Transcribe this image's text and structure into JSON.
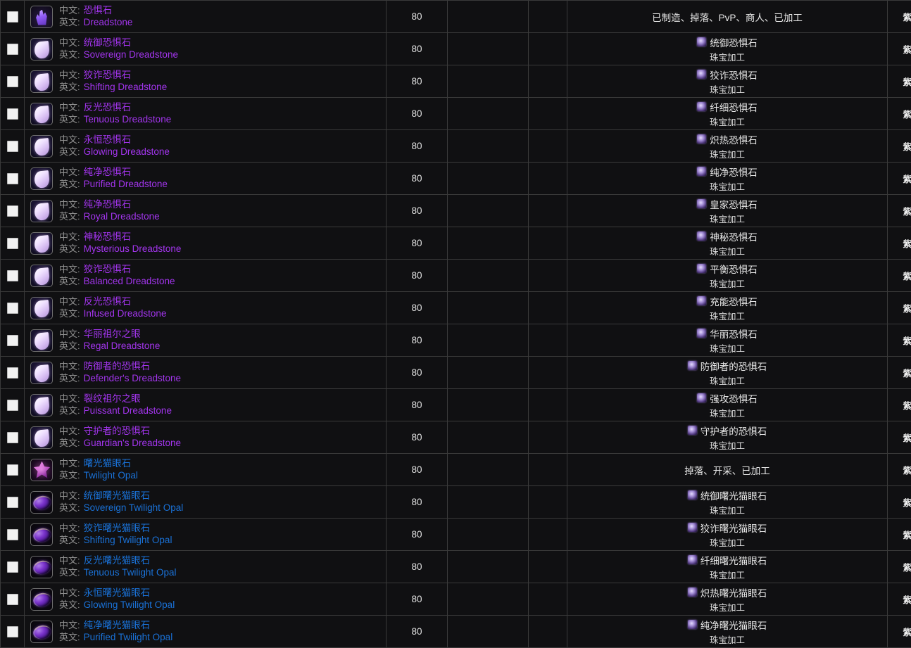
{
  "labels": {
    "chinese_prefix": "中文:",
    "english_prefix": "英文:",
    "profession": "珠宝加工",
    "category_purple_gem": "紫色宝石"
  },
  "colors": {
    "epic_purple": "#a335ee",
    "rare_blue": "#1a72d8",
    "row_background": "#101012",
    "grid_line": "#3a3a3a"
  },
  "rows": [
    {
      "icon": "crystal-cluster-icon",
      "quality": "epic",
      "cn": "恐惧石",
      "en": "Dreadstone",
      "level": "80",
      "source_text": "已制造、掉落、PvP、商人、已加工",
      "source_item": null,
      "source_prof": null,
      "category": "紫色宝石"
    },
    {
      "icon": "teardrop-gem-icon",
      "quality": "epic",
      "cn": "统御恐惧石",
      "en": "Sovereign Dreadstone",
      "level": "80",
      "source_text": null,
      "source_item": "统御恐惧石",
      "source_prof": "珠宝加工",
      "category": "紫色宝石"
    },
    {
      "icon": "teardrop-gem-icon",
      "quality": "epic",
      "cn": "狡诈恐惧石",
      "en": "Shifting Dreadstone",
      "level": "80",
      "source_text": null,
      "source_item": "狡诈恐惧石",
      "source_prof": "珠宝加工",
      "category": "紫色宝石"
    },
    {
      "icon": "teardrop-gem-icon",
      "quality": "epic",
      "cn": "反光恐惧石",
      "en": "Tenuous Dreadstone",
      "level": "80",
      "source_text": null,
      "source_item": "纤细恐惧石",
      "source_prof": "珠宝加工",
      "category": "紫色宝石"
    },
    {
      "icon": "teardrop-gem-icon",
      "quality": "epic",
      "cn": "永恒恐惧石",
      "en": "Glowing Dreadstone",
      "level": "80",
      "source_text": null,
      "source_item": "炽热恐惧石",
      "source_prof": "珠宝加工",
      "category": "紫色宝石"
    },
    {
      "icon": "teardrop-gem-icon",
      "quality": "epic",
      "cn": "纯净恐惧石",
      "en": "Purified Dreadstone",
      "level": "80",
      "source_text": null,
      "source_item": "纯净恐惧石",
      "source_prof": "珠宝加工",
      "category": "紫色宝石"
    },
    {
      "icon": "teardrop-gem-icon",
      "quality": "epic",
      "cn": "纯净恐惧石",
      "en": "Royal Dreadstone",
      "level": "80",
      "source_text": null,
      "source_item": "皇家恐惧石",
      "source_prof": "珠宝加工",
      "category": "紫色宝石"
    },
    {
      "icon": "teardrop-gem-icon",
      "quality": "epic",
      "cn": "神秘恐惧石",
      "en": "Mysterious Dreadstone",
      "level": "80",
      "source_text": null,
      "source_item": "神秘恐惧石",
      "source_prof": "珠宝加工",
      "category": "紫色宝石"
    },
    {
      "icon": "teardrop-gem-icon",
      "quality": "epic",
      "cn": "狡诈恐惧石",
      "en": "Balanced Dreadstone",
      "level": "80",
      "source_text": null,
      "source_item": "平衡恐惧石",
      "source_prof": "珠宝加工",
      "category": "紫色宝石"
    },
    {
      "icon": "teardrop-gem-icon",
      "quality": "epic",
      "cn": "反光恐惧石",
      "en": "Infused Dreadstone",
      "level": "80",
      "source_text": null,
      "source_item": "充能恐惧石",
      "source_prof": "珠宝加工",
      "category": "紫色宝石"
    },
    {
      "icon": "teardrop-gem-icon",
      "quality": "epic",
      "cn": "华丽祖尔之眼",
      "en": "Regal Dreadstone",
      "level": "80",
      "source_text": null,
      "source_item": "华丽恐惧石",
      "source_prof": "珠宝加工",
      "category": "紫色宝石"
    },
    {
      "icon": "teardrop-gem-icon",
      "quality": "epic",
      "cn": "防御者的恐惧石",
      "en": "Defender's Dreadstone",
      "level": "80",
      "source_text": null,
      "source_item": "防御者的恐惧石",
      "source_prof": "珠宝加工",
      "category": "紫色宝石"
    },
    {
      "icon": "teardrop-gem-icon",
      "quality": "epic",
      "cn": "裂纹祖尔之眼",
      "en": "Puissant Dreadstone",
      "level": "80",
      "source_text": null,
      "source_item": "强攻恐惧石",
      "source_prof": "珠宝加工",
      "category": "紫色宝石"
    },
    {
      "icon": "teardrop-gem-icon",
      "quality": "epic",
      "cn": "守护者的恐惧石",
      "en": "Guardian's Dreadstone",
      "level": "80",
      "source_text": null,
      "source_item": "守护者的恐惧石",
      "source_prof": "珠宝加工",
      "category": "紫色宝石"
    },
    {
      "icon": "star-opal-icon",
      "quality": "rare",
      "cn": "曙光猫眼石",
      "en": "Twilight Opal",
      "level": "80",
      "source_text": "掉落、开采、已加工",
      "source_item": null,
      "source_prof": null,
      "category": "紫色宝石"
    },
    {
      "icon": "oval-opal-icon",
      "quality": "rare",
      "cn": "统御曙光猫眼石",
      "en": "Sovereign Twilight Opal",
      "level": "80",
      "source_text": null,
      "source_item": "统御曙光猫眼石",
      "source_prof": "珠宝加工",
      "category": "紫色宝石"
    },
    {
      "icon": "oval-opal-icon",
      "quality": "rare",
      "cn": "狡诈曙光猫眼石",
      "en": "Shifting Twilight Opal",
      "level": "80",
      "source_text": null,
      "source_item": "狡诈曙光猫眼石",
      "source_prof": "珠宝加工",
      "category": "紫色宝石"
    },
    {
      "icon": "oval-opal-icon",
      "quality": "rare",
      "cn": "反光曙光猫眼石",
      "en": "Tenuous Twilight Opal",
      "level": "80",
      "source_text": null,
      "source_item": "纤细曙光猫眼石",
      "source_prof": "珠宝加工",
      "category": "紫色宝石"
    },
    {
      "icon": "oval-opal-icon",
      "quality": "rare",
      "cn": "永恒曙光猫眼石",
      "en": "Glowing Twilight Opal",
      "level": "80",
      "source_text": null,
      "source_item": "炽热曙光猫眼石",
      "source_prof": "珠宝加工",
      "category": "紫色宝石"
    },
    {
      "icon": "oval-opal-icon",
      "quality": "rare",
      "cn": "纯净曙光猫眼石",
      "en": "Purified Twilight Opal",
      "level": "80",
      "source_text": null,
      "source_item": "纯净曙光猫眼石",
      "source_prof": "珠宝加工",
      "category": "紫色宝石"
    }
  ]
}
